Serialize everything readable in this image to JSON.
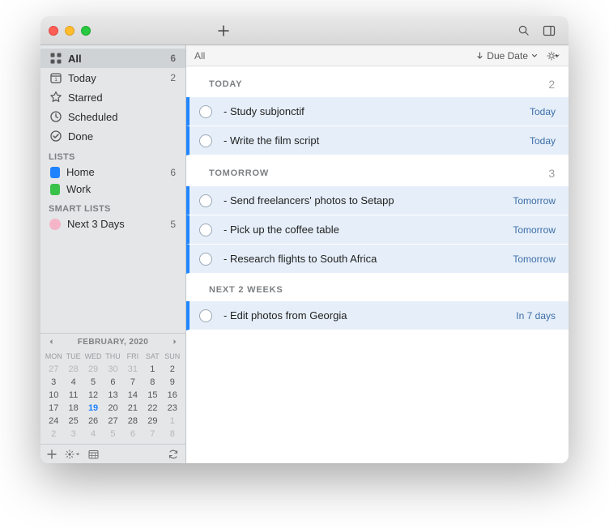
{
  "sidebar": {
    "smart_items": [
      {
        "key": "all",
        "label": "All",
        "count": "6",
        "active": true
      },
      {
        "key": "today",
        "label": "Today",
        "count": "2"
      },
      {
        "key": "starred",
        "label": "Starred",
        "count": ""
      },
      {
        "key": "scheduled",
        "label": "Scheduled",
        "count": ""
      },
      {
        "key": "done",
        "label": "Done",
        "count": ""
      }
    ],
    "lists_label": "LISTS",
    "lists": [
      {
        "label": "Home",
        "count": "6",
        "color_class": "dot-blue"
      },
      {
        "label": "Work",
        "count": "",
        "color_class": "dot-green"
      }
    ],
    "smart_lists_label": "SMART LISTS",
    "smart_lists": [
      {
        "label": "Next 3 Days",
        "count": "5"
      }
    ]
  },
  "calendar": {
    "title": "FEBRUARY, 2020",
    "daynames": [
      "MON",
      "TUE",
      "WED",
      "THU",
      "FRI",
      "SAT",
      "SUN"
    ],
    "days": [
      {
        "n": "27",
        "muted": true
      },
      {
        "n": "28",
        "muted": true
      },
      {
        "n": "29",
        "muted": true
      },
      {
        "n": "30",
        "muted": true
      },
      {
        "n": "31",
        "muted": true
      },
      {
        "n": "1"
      },
      {
        "n": "2"
      },
      {
        "n": "3"
      },
      {
        "n": "4"
      },
      {
        "n": "5"
      },
      {
        "n": "6"
      },
      {
        "n": "7"
      },
      {
        "n": "8"
      },
      {
        "n": "9"
      },
      {
        "n": "10"
      },
      {
        "n": "11"
      },
      {
        "n": "12"
      },
      {
        "n": "13"
      },
      {
        "n": "14"
      },
      {
        "n": "15"
      },
      {
        "n": "16"
      },
      {
        "n": "17"
      },
      {
        "n": "18"
      },
      {
        "n": "19",
        "today": true
      },
      {
        "n": "20"
      },
      {
        "n": "21"
      },
      {
        "n": "22"
      },
      {
        "n": "23"
      },
      {
        "n": "24"
      },
      {
        "n": "25"
      },
      {
        "n": "26"
      },
      {
        "n": "27"
      },
      {
        "n": "28"
      },
      {
        "n": "29"
      },
      {
        "n": "1",
        "muted": true
      },
      {
        "n": "2",
        "muted": true
      },
      {
        "n": "3",
        "muted": true
      },
      {
        "n": "4",
        "muted": true
      },
      {
        "n": "5",
        "muted": true
      },
      {
        "n": "6",
        "muted": true
      },
      {
        "n": "7",
        "muted": true
      },
      {
        "n": "8",
        "muted": true
      }
    ]
  },
  "main": {
    "title": "All",
    "sort_label": "Due Date",
    "groups": [
      {
        "label": "TODAY",
        "count": "2",
        "tasks": [
          {
            "title": "- Study subjonctif",
            "due": "Today"
          },
          {
            "title": "- Write the film script",
            "due": "Today"
          }
        ]
      },
      {
        "label": "TOMORROW",
        "count": "3",
        "tasks": [
          {
            "title": "- Send freelancers' photos to Setapp",
            "due": "Tomorrow"
          },
          {
            "title": "- Pick up the coffee table",
            "due": "Tomorrow"
          },
          {
            "title": "- Research flights to South Africa",
            "due": "Tomorrow"
          }
        ]
      },
      {
        "label": "NEXT 2 WEEKS",
        "count": "",
        "tasks": [
          {
            "title": "- Edit photos from Georgia",
            "due": "In 7 days"
          }
        ]
      }
    ]
  }
}
